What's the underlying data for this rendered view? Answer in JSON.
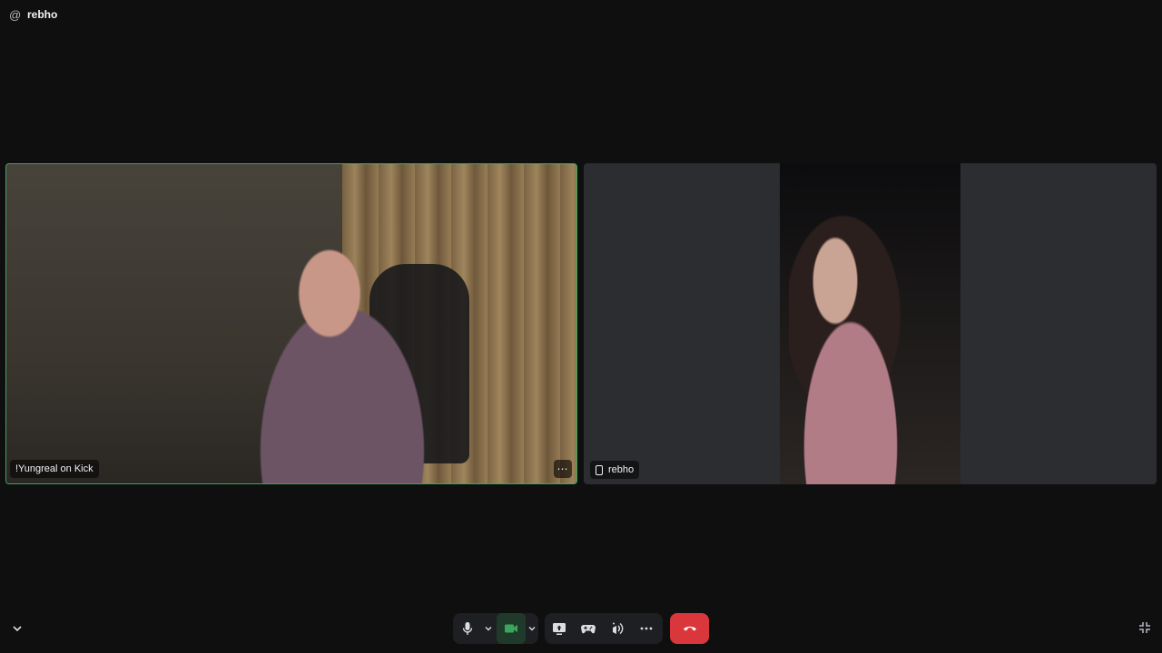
{
  "header": {
    "channel_icon": "at-sign-icon",
    "channel_symbol": "@",
    "channel_name": "rebho"
  },
  "participants": [
    {
      "name": "!Yungreal on Kick",
      "speaking": true,
      "more_label": "⋯"
    },
    {
      "name": "rebho",
      "device_icon": "mobile-phone-icon"
    }
  ],
  "controls": {
    "microphone": "microphone-icon",
    "microphone_options": "chevron-down-icon",
    "camera": "video-camera-icon",
    "camera_options": "chevron-down-icon",
    "screen_share": "screen-share-icon",
    "activities": "gamepad-icon",
    "soundboard": "soundboard-icon",
    "more": "more-horizontal-icon",
    "disconnect": "hang-up-icon",
    "collapse": "chevron-down-icon",
    "exit_fullscreen": "minimize-icon"
  },
  "colors": {
    "background": "#0f0f10",
    "speaking_border": "#3ba55d",
    "disconnect": "#da373c",
    "camera_active": "#3ba55d"
  }
}
